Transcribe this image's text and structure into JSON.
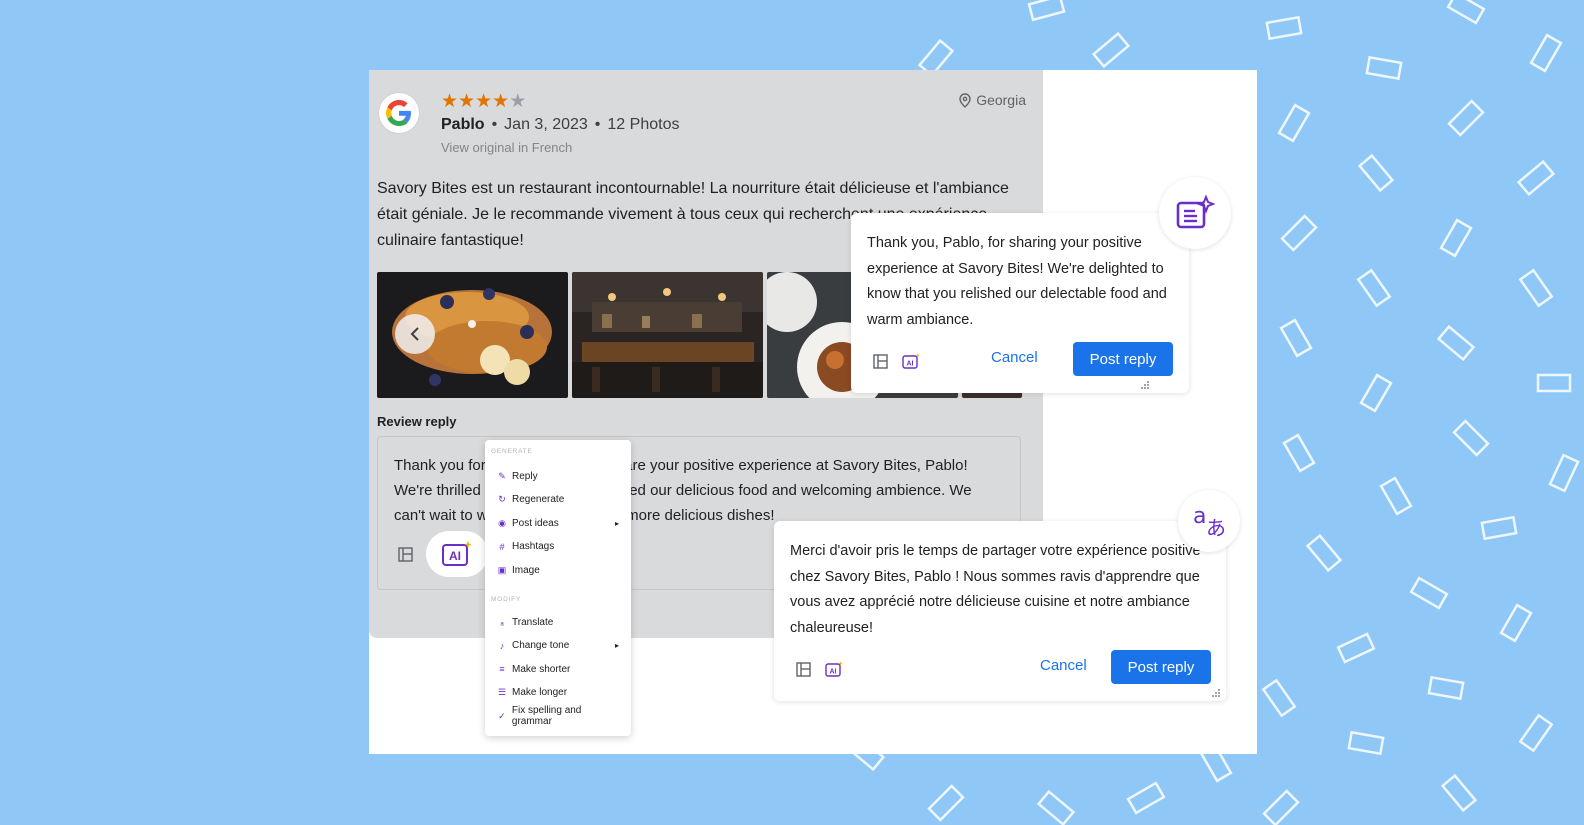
{
  "review": {
    "rating": 4,
    "max_rating": 5,
    "author": "Pablo",
    "date": "Jan 3, 2023",
    "photos_count": "12 Photos",
    "view_original": "View original in French",
    "location": "Georgia",
    "text": "Savory Bites est un restaurant incontournable! La nourriture était délicieuse et l'ambiance était géniale. Je le recommande vivement à tous ceux qui recherchent une expérience culinaire fantastique!",
    "photo_alts": [
      "french-toast-photo",
      "restaurant-bar-photo",
      "plated-dish-photo"
    ]
  },
  "reply": {
    "section_title": "Review reply",
    "text": "Thank you for taking the time to share your positive experience at Savory Bites, Pablo! We're thrilled to hear that you enjoyed our delicious food and welcoming ambience. We can't wait to welcome you back for more delicious dishes!",
    "ai_label": "AI"
  },
  "ai_menu": {
    "generate_label": "GENERATE",
    "modify_label": "MODIFY",
    "generate_items": [
      {
        "label": "Reply",
        "icon": "reply-icon"
      },
      {
        "label": "Regenerate",
        "icon": "regenerate-icon"
      },
      {
        "label": "Post ideas",
        "icon": "lightbulb-icon",
        "submenu": true
      },
      {
        "label": "Hashtags",
        "icon": "hashtag-icon"
      },
      {
        "label": "Image",
        "icon": "image-icon"
      }
    ],
    "modify_items": [
      {
        "label": "Translate",
        "icon": "translate-icon"
      },
      {
        "label": "Change tone",
        "icon": "tone-icon",
        "submenu": true
      },
      {
        "label": "Make shorter",
        "icon": "shorter-icon"
      },
      {
        "label": "Make longer",
        "icon": "longer-icon"
      },
      {
        "label": "Fix spelling and grammar",
        "icon": "spellcheck-icon"
      }
    ]
  },
  "generated_reply": {
    "text": "Thank you, Pablo, for sharing your positive experience at Savory Bites! We're delighted to know that you relished our delectable food and warm ambiance.",
    "cancel_label": "Cancel",
    "post_label": "Post reply",
    "badge_icon": "ai-sparkle-document-icon"
  },
  "translated_reply": {
    "text": "Merci d'avoir pris le temps de partager votre expérience positive chez Savory Bites, Pablo ! Nous sommes ravis d'apprendre que vous avez apprécié notre délicieuse cuisine et notre ambiance chaleureuse!",
    "cancel_label": "Cancel",
    "post_label": "Post reply",
    "badge_icon": "translate-icon"
  },
  "colors": {
    "page_background": "#8fc8f7",
    "card_background": "#d9dadc",
    "accent_blue": "#1a73e8",
    "ai_purple": "#6b2fc9",
    "star": "#e37400"
  }
}
